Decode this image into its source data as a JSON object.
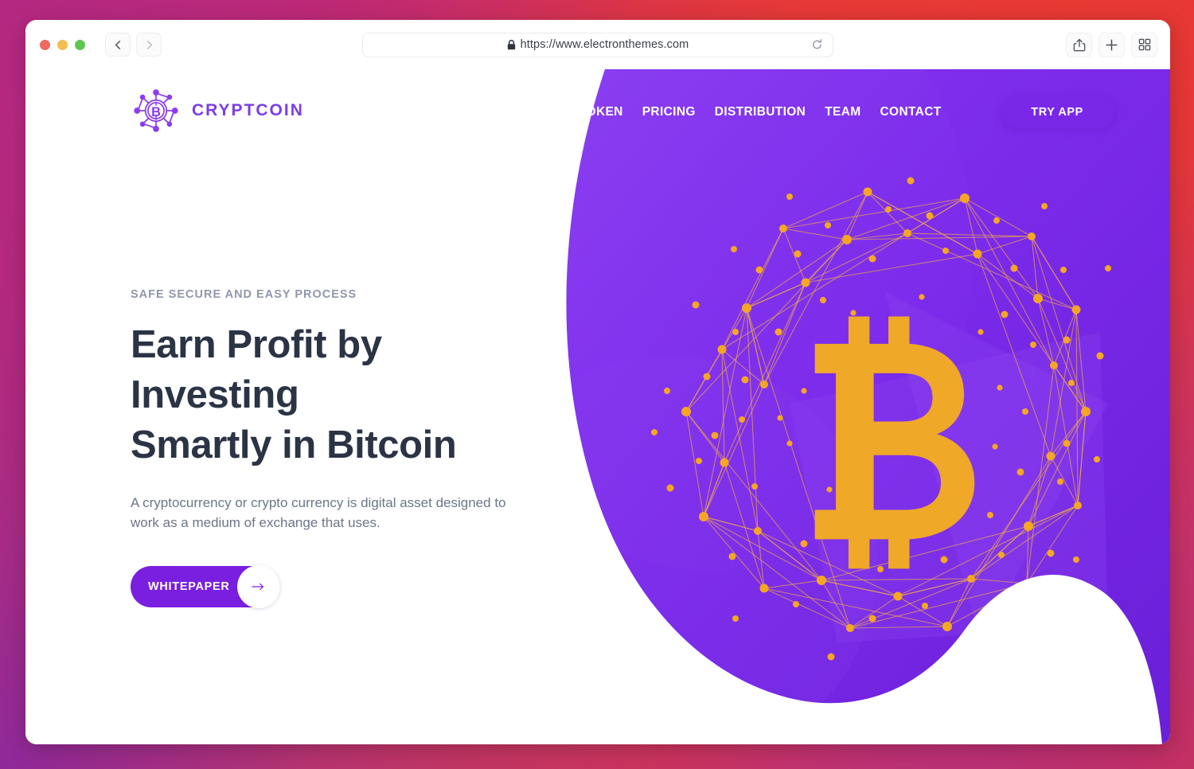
{
  "browser": {
    "traffic_lights": [
      "close",
      "minimize",
      "maximize"
    ],
    "back_label": "Back",
    "forward_label": "Forward",
    "url": "https://www.electronthemes.com",
    "lock_icon": "lock-icon",
    "reload_icon": "reload-icon",
    "share_icon": "share-icon",
    "new_tab_icon": "plus-icon",
    "tab_overview_icon": "tab-grid-icon"
  },
  "site": {
    "logo_text": "CRYPTCOIN",
    "logo_icon": "crypto-network-bitcoin-icon",
    "nav": [
      {
        "label": "TOKEN"
      },
      {
        "label": "PRICING"
      },
      {
        "label": "DISTRIBUTION"
      },
      {
        "label": "TEAM"
      },
      {
        "label": "CONTACT"
      }
    ],
    "cta": {
      "label": "TRY APP"
    }
  },
  "hero": {
    "eyebrow": "SAFE SECURE AND EASY PROCESS",
    "title_line1": "Earn Profit by Investing",
    "title_line2": "Smartly in Bitcoin",
    "subtitle": "A cryptocurrency or crypto currency is digital asset designed to work as a medium of exchange that uses.",
    "button_label": "WHITEPAPER",
    "button_arrow_icon": "arrow-right-icon"
  },
  "artwork": {
    "symbol": "bitcoin-symbol",
    "network_icon": "node-network-ring-icon"
  },
  "colors": {
    "brand_purple": "#7d3ce8",
    "panel_purple": "#7a2ae8",
    "panel_purple_dark": "#6a1fd8",
    "bitcoin_gold": "#f0a828",
    "heading_navy": "#2b3445",
    "body_grey": "#6d7588",
    "eyebrow_grey": "#8f97aa",
    "frame_magenta": "#b82a7e",
    "frame_red": "#e8373a",
    "frame_rose": "#c9305c",
    "frame_purple": "#8a28a0"
  }
}
